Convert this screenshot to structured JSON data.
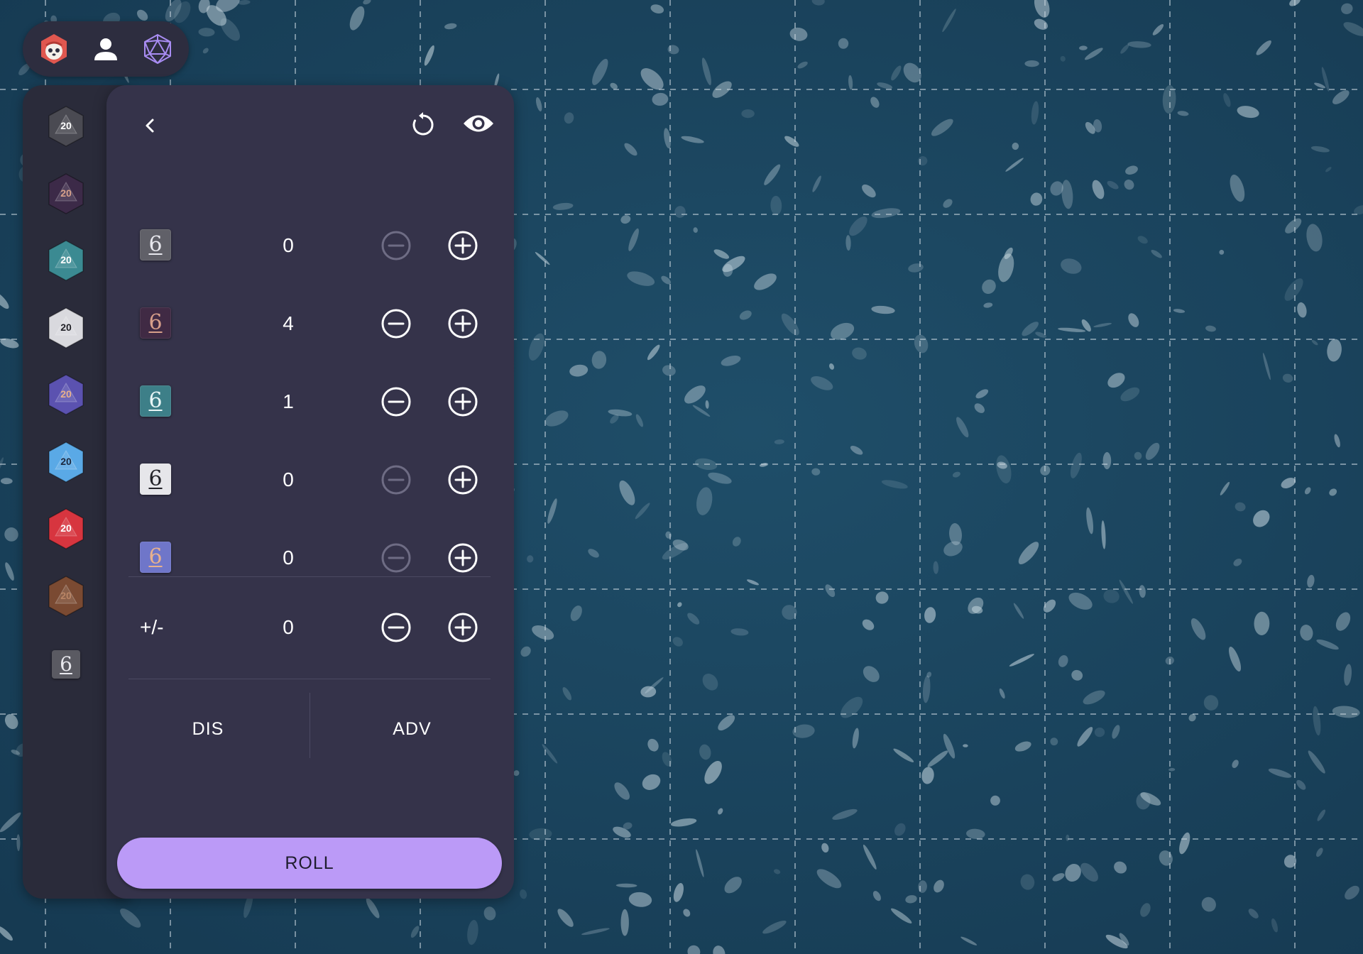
{
  "panel": {
    "dice": [
      {
        "die": "6",
        "count": "0",
        "minus_enabled": false,
        "face": "#606068",
        "digit": "#e8e8ee"
      },
      {
        "die": "6",
        "count": "4",
        "minus_enabled": true,
        "face": "#402a44",
        "digit": "#d79f8a"
      },
      {
        "die": "6",
        "count": "1",
        "minus_enabled": true,
        "face": "#3d7f88",
        "digit": "#e8f6f6"
      },
      {
        "die": "6",
        "count": "0",
        "minus_enabled": false,
        "face": "#e6e6ea",
        "digit": "#222228"
      },
      {
        "die": "6",
        "count": "0",
        "minus_enabled": false,
        "face": "#6f76c9",
        "digit": "#e8b18d"
      }
    ],
    "modifier": {
      "label": "+/-",
      "value": "0"
    },
    "dis_label": "DIS",
    "adv_label": "ADV",
    "roll_label": "ROLL"
  },
  "rail": {
    "dice": [
      {
        "label": "20",
        "color": "#4a4a52",
        "text": "#ffffff"
      },
      {
        "label": "20",
        "color": "#3c2a48",
        "text": "#d7a08a"
      },
      {
        "label": "20",
        "color": "#3b8a92",
        "text": "#ffffff"
      },
      {
        "label": "20",
        "color": "#d9d9de",
        "text": "#222228"
      },
      {
        "label": "20",
        "color": "#5b52b0",
        "text": "#e9b08c"
      },
      {
        "label": "20",
        "color": "#5aa9e6",
        "text": "#1c2a40"
      },
      {
        "label": "20",
        "color": "#d7353f",
        "text": "#ffffff"
      },
      {
        "label": "20",
        "color": "#7a4a32",
        "text": "#b98565"
      }
    ],
    "d6_label": "6"
  },
  "colors": {
    "accent": "#bb9af7",
    "panel": "#35334a",
    "rail": "#2a2b3a",
    "icon": "#ffffff",
    "icon_disabled": "#6e6c84"
  },
  "icons": {
    "toolbar": [
      "panda-avatar-icon",
      "user-icon",
      "d20-outline-icon"
    ],
    "header": [
      "chevron-left-icon",
      "reset-icon",
      "eye-icon"
    ],
    "controls": [
      "minus-circle-icon",
      "plus-circle-icon"
    ]
  }
}
